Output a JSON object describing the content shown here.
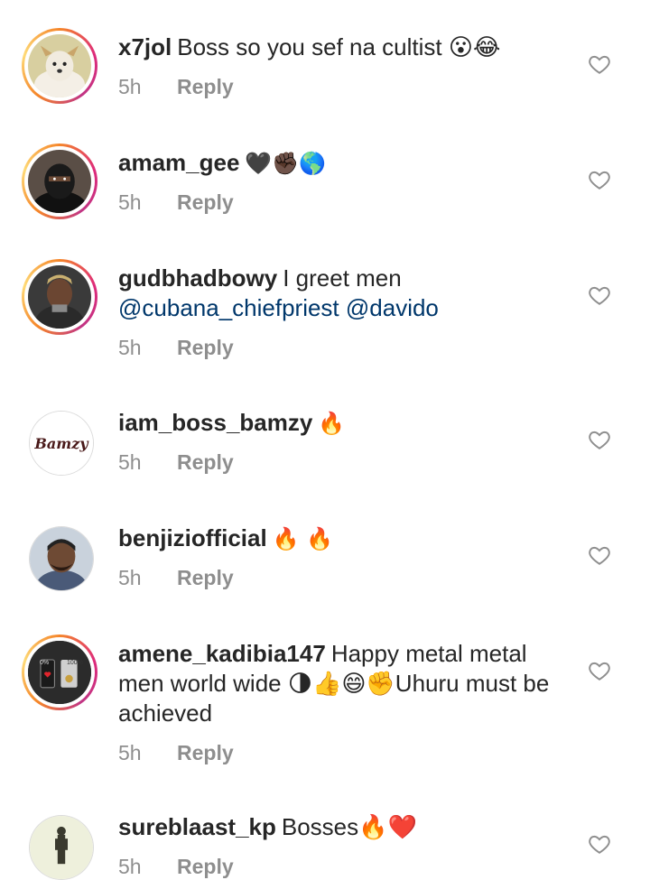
{
  "comments": [
    {
      "username": "x7jol",
      "text": "Boss so you sef na cultist 😮😂",
      "time": "5h",
      "reply": "Reply"
    },
    {
      "username": "amam_gee",
      "text": "🖤✊🏿🌎",
      "time": "5h",
      "reply": "Reply"
    },
    {
      "username": "gudbhadbowy",
      "text": "I greet men",
      "mentions": "@cubana_chiefpriest @davido",
      "time": "5h",
      "reply": "Reply"
    },
    {
      "username": "iam_boss_bamzy",
      "text": "🔥",
      "avatar_text": "Bamzy",
      "time": "5h",
      "reply": "Reply"
    },
    {
      "username": "benjiziofficial",
      "text": "🔥 🔥",
      "time": "5h",
      "reply": "Reply"
    },
    {
      "username": "amene_kadibia147",
      "text": "Happy metal metal men world wide 🌗👍😄✊Uhuru must be achieved",
      "avatar_labels": [
        "0%",
        "100%"
      ],
      "time": "5h",
      "reply": "Reply"
    },
    {
      "username": "sureblaast_kp",
      "text": "Bosses🔥❤️",
      "time": "5h",
      "reply": "Reply"
    }
  ],
  "icons": {
    "like": "heart-outline-icon"
  },
  "colors": {
    "mention": "#00376b",
    "meta": "#8e8e8e",
    "ring_start": "#f58529",
    "ring_mid": "#dd2a7b"
  }
}
